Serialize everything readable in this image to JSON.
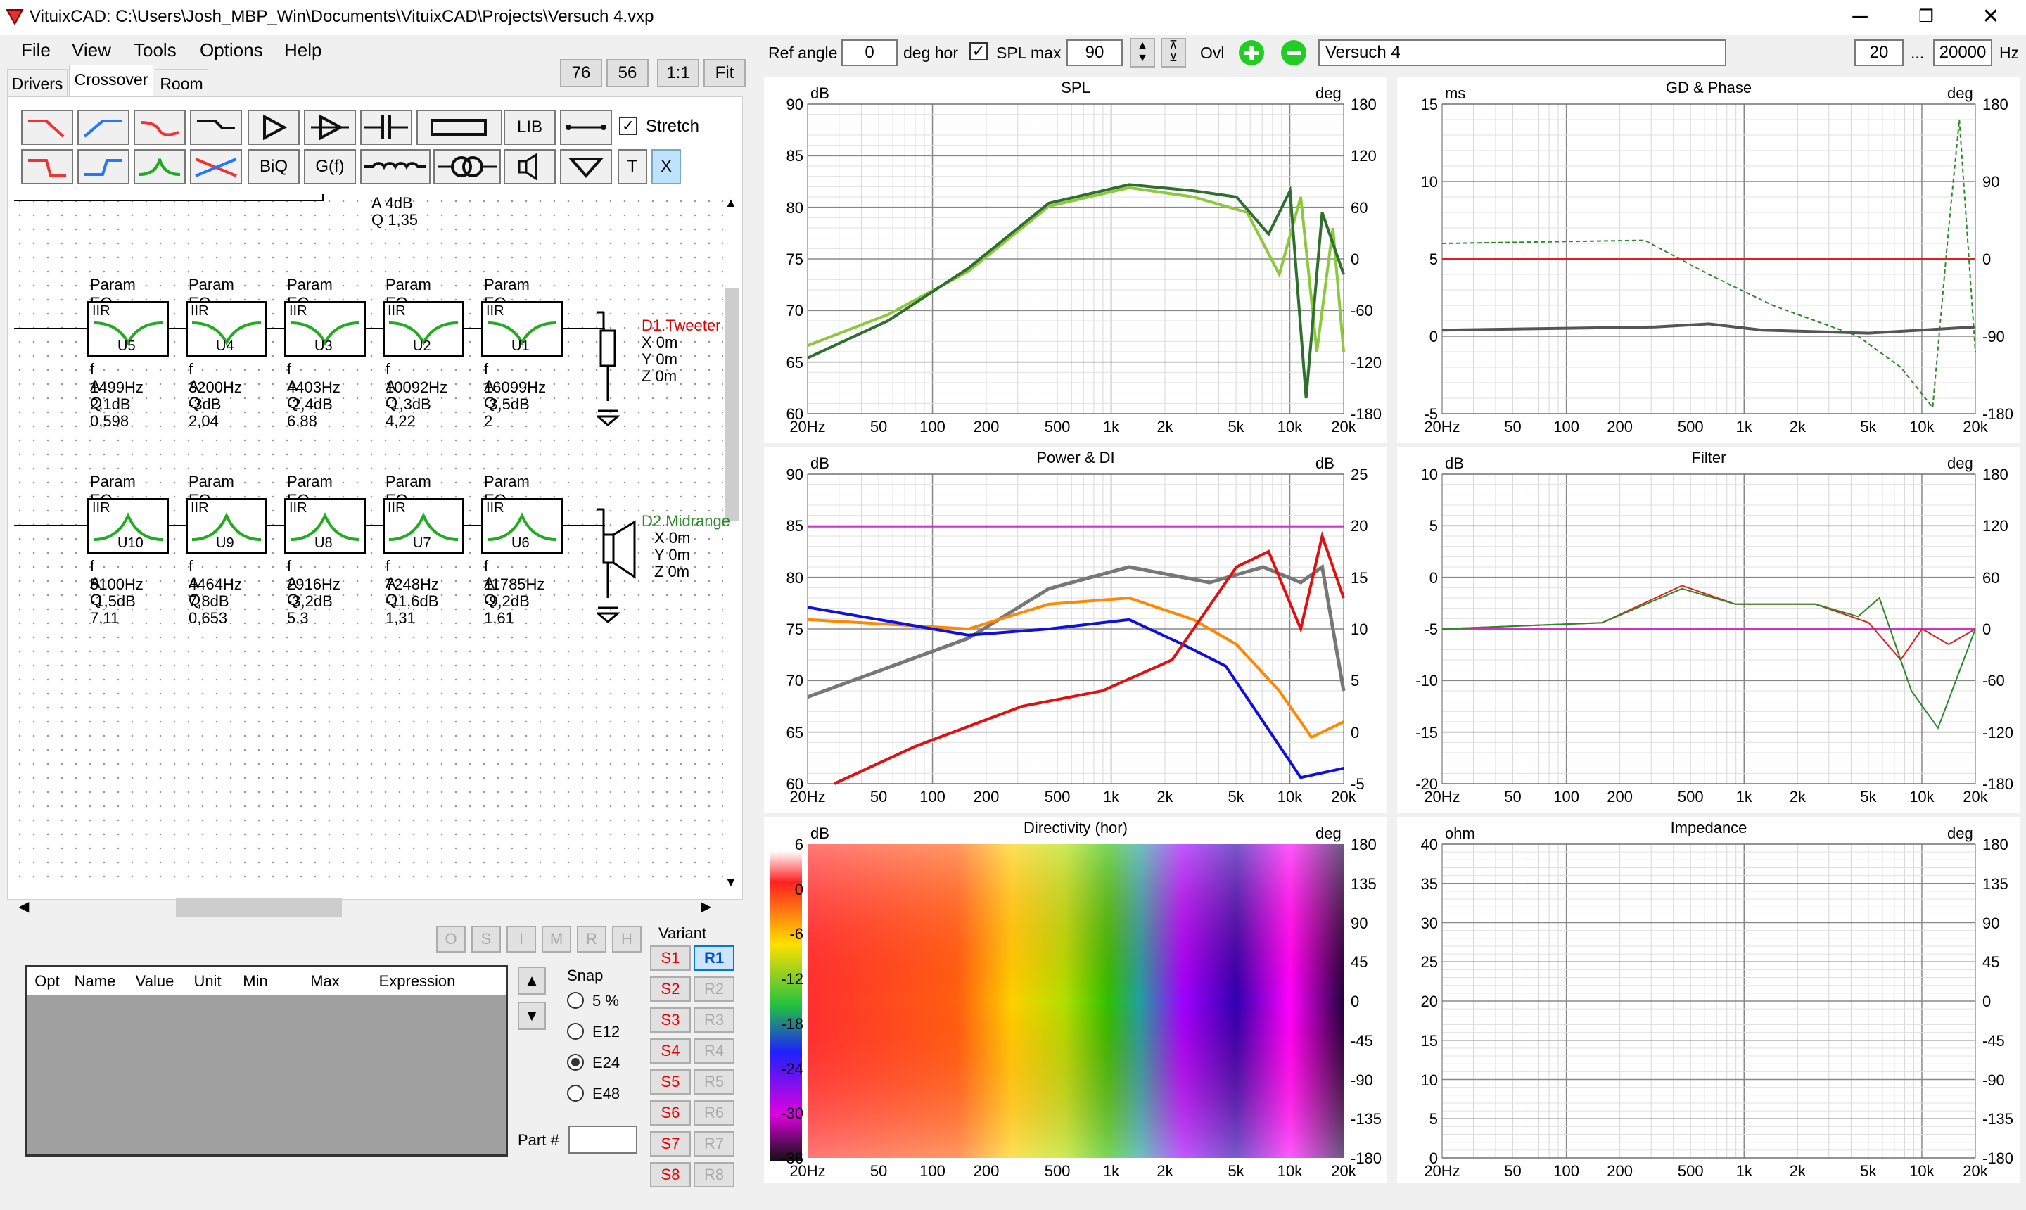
{
  "window": {
    "title": "VituixCAD: C:\\Users\\Josh_MBP_Win\\Documents\\VituixCAD\\Projects\\Versuch 4.vxp",
    "minimize": "─",
    "restore": "❐",
    "close": "✕"
  },
  "menu": [
    "File",
    "View",
    "Tools",
    "Options",
    "Help"
  ],
  "zoom_buttons": [
    "76",
    "56",
    "1:1",
    "Fit"
  ],
  "tabs": [
    "Drivers",
    "Crossover",
    "Room"
  ],
  "toolbar": {
    "lib": "LIB",
    "biq": "BiQ",
    "gf": "G(f)",
    "t": "T",
    "x": "X",
    "stretch": "Stretch"
  },
  "top_eq": {
    "a": "A  4dB",
    "q": "Q  1,35"
  },
  "tweeter_chain": {
    "label": "D1.Tweeter",
    "coords": [
      "X  0m",
      "Y  0m",
      "Z  0m"
    ],
    "blocks": [
      {
        "title": "Param EQ",
        "id": "U5",
        "f": "f   1499Hz",
        "a": "A  2,1dB",
        "q": "Q  0,598"
      },
      {
        "title": "Param EQ",
        "id": "U4",
        "f": "f   3200Hz",
        "a": "A  -3dB",
        "q": "Q  2,04"
      },
      {
        "title": "Param EQ",
        "id": "U3",
        "f": "f   4403Hz",
        "a": "A  -2,4dB",
        "q": "Q  6,88"
      },
      {
        "title": "Param EQ",
        "id": "U2",
        "f": "f   10092Hz",
        "a": "A  -1,3dB",
        "q": "Q  4,22"
      },
      {
        "title": "Param EQ",
        "id": "U1",
        "f": "f   16099Hz",
        "a": "A  -3,5dB",
        "q": "Q  2"
      }
    ]
  },
  "midrange_chain": {
    "label": "D2.Midrange",
    "coords": [
      "X  0m",
      "Y  0m",
      "Z  0m"
    ],
    "blocks": [
      {
        "title": "Param EQ",
        "id": "U10",
        "f": "f   5100Hz",
        "a": "A  -1,5dB",
        "q": "Q  7,11"
      },
      {
        "title": "Param EQ",
        "id": "U9",
        "f": "f   4464Hz",
        "a": "A  7,8dB",
        "q": "Q  0,653"
      },
      {
        "title": "Param EQ",
        "id": "U8",
        "f": "f   2916Hz",
        "a": "A  -3,2dB",
        "q": "Q  5,3"
      },
      {
        "title": "Param EQ",
        "id": "U7",
        "f": "f   7248Hz",
        "a": "A  -11,6dB",
        "q": "Q  1,31"
      },
      {
        "title": "Param EQ",
        "id": "U6",
        "f": "f   11785Hz",
        "a": "A  -9,2dB",
        "q": "Q  1,61"
      }
    ]
  },
  "mode_buttons": [
    "O",
    "S",
    "I",
    "M",
    "R",
    "H"
  ],
  "param_table": {
    "columns": [
      "Opt",
      "Name",
      "Value",
      "Unit",
      "Min",
      "Max",
      "Expression"
    ]
  },
  "snap": {
    "title": "Snap",
    "options": [
      "5 %",
      "E12",
      "E24",
      "E48"
    ],
    "selected": "E24"
  },
  "part_label": "Part #",
  "variant": {
    "title": "Variant",
    "s": [
      "S1",
      "S2",
      "S3",
      "S4",
      "S5",
      "S6",
      "S7",
      "S8"
    ],
    "r": [
      "R1",
      "R2",
      "R3",
      "R4",
      "R5",
      "R6",
      "R7",
      "R8"
    ],
    "active_r": "R1"
  },
  "controls": {
    "ref_angle_label": "Ref angle",
    "ref_angle": "0",
    "deg_hor": "deg hor",
    "spl_max_label": "SPL max",
    "spl_max": "90",
    "ovl": "Ovl",
    "overlay_name": "Versuch 4",
    "f_min": "20",
    "f_sep": "...",
    "f_max": "20000",
    "hz": "Hz"
  },
  "x_ticks": [
    "20Hz",
    "50",
    "100",
    "200",
    "500",
    "1k",
    "2k",
    "5k",
    "10k",
    "20k"
  ],
  "charts": {
    "spl": {
      "title": "SPL",
      "lu": "dB",
      "ru": "deg",
      "left": [
        "90",
        "85",
        "80",
        "75",
        "70",
        "65",
        "60"
      ],
      "right": [
        "180",
        "120",
        "60",
        "0",
        "-60",
        "-120",
        "-180"
      ]
    },
    "gd": {
      "title": "GD & Phase",
      "lu": "ms",
      "ru": "deg",
      "left": [
        "15",
        "10",
        "5",
        "0",
        "-5"
      ],
      "right": [
        "180",
        "90",
        "0",
        "-90",
        "-180"
      ]
    },
    "power": {
      "title": "Power & DI",
      "lu": "dB",
      "ru": "dB",
      "left": [
        "90",
        "85",
        "80",
        "75",
        "70",
        "65",
        "60"
      ],
      "right": [
        "25",
        "20",
        "15",
        "10",
        "5",
        "0",
        "-5"
      ]
    },
    "filter": {
      "title": "Filter",
      "lu": "dB",
      "ru": "deg",
      "left": [
        "10",
        "5",
        "0",
        "-5",
        "-10",
        "-15",
        "-20"
      ],
      "right": [
        "180",
        "120",
        "60",
        "0",
        "-60",
        "-120",
        "-180"
      ]
    },
    "directivity": {
      "title": "Directivity (hor)",
      "lu": "dB",
      "ru": "deg",
      "left": [
        "6",
        "0",
        "-6",
        "-12",
        "-18",
        "-24",
        "-30",
        "-36"
      ],
      "right": [
        "180",
        "135",
        "90",
        "45",
        "0",
        "-45",
        "-90",
        "-135",
        "-180"
      ]
    },
    "impedance": {
      "title": "Impedance",
      "lu": "ohm",
      "ru": "deg",
      "left": [
        "40",
        "35",
        "30",
        "25",
        "20",
        "15",
        "10",
        "5",
        "0"
      ],
      "right": [
        "180",
        "135",
        "90",
        "45",
        "0",
        "-45",
        "-90",
        "-135",
        "-180"
      ]
    }
  }
}
